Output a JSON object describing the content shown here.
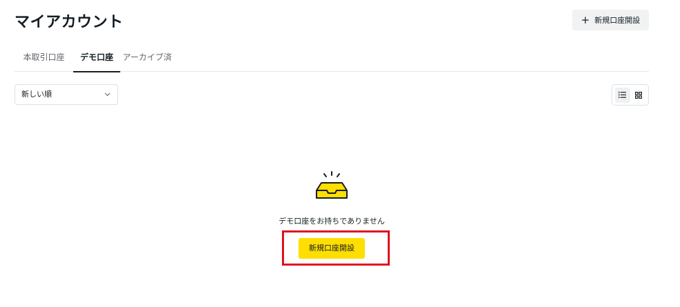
{
  "header": {
    "title": "マイアカウント",
    "open_account_label": "新規口座開設"
  },
  "tabs": [
    {
      "label": "本取引口座",
      "active": false
    },
    {
      "label": "デモ口座",
      "active": true
    },
    {
      "label": "アーカイブ済",
      "active": false
    }
  ],
  "filters": {
    "sort_value": "新しい順"
  },
  "view_toggle": {
    "selected": "list"
  },
  "empty_state": {
    "message": "デモ口座をお持ちでありません",
    "button_label": "新規口座開設"
  },
  "colors": {
    "accent_yellow": "#ffde02",
    "highlight_red": "#e0101e",
    "text_dark": "#141d22"
  }
}
